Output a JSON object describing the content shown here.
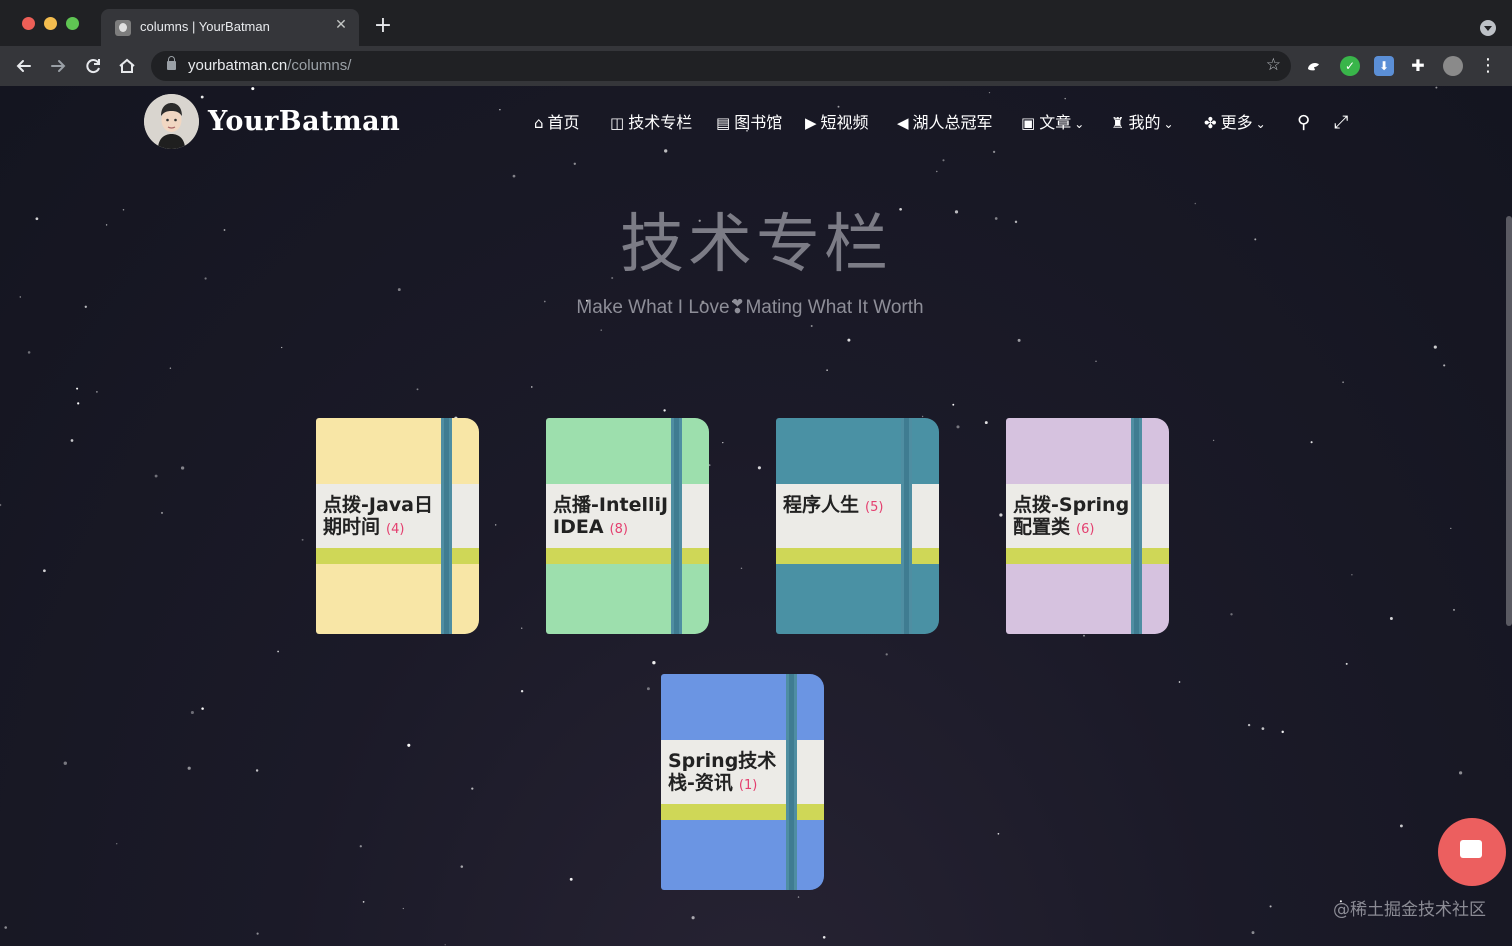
{
  "browser": {
    "tab_title": "columns | YourBatman",
    "tab_close": "✕",
    "new_tab": "+",
    "url_host": "yourbatman.cn",
    "url_path": "/columns/"
  },
  "site": {
    "title": "YourBatman",
    "nav": [
      {
        "icon": "home-icon",
        "glyph": "⌂",
        "label": "首页",
        "dropdown": false
      },
      {
        "icon": "columns-icon",
        "glyph": "◫",
        "label": "技术专栏",
        "dropdown": false
      },
      {
        "icon": "book-icon",
        "glyph": "▤",
        "label": "图书馆",
        "dropdown": false
      },
      {
        "icon": "video-icon",
        "glyph": "▶",
        "label": "短视频",
        "dropdown": false
      },
      {
        "icon": "megaphone-icon",
        "glyph": "◀",
        "label": "湖人总冠军",
        "dropdown": false
      },
      {
        "icon": "article-icon",
        "glyph": "▣",
        "label": "文章",
        "dropdown": true
      },
      {
        "icon": "user-icon",
        "glyph": "♜",
        "label": "我的",
        "dropdown": true
      },
      {
        "icon": "more-icon",
        "glyph": "✤",
        "label": "更多",
        "dropdown": true
      }
    ]
  },
  "main": {
    "heading": "技术专栏",
    "subtitle": "Make What I Love❣Mating What It Worth",
    "columns": [
      {
        "title": "点拨-Java日期时间",
        "count": "(4)",
        "color": "#f8e6a6"
      },
      {
        "title": "点播-IntelliJ IDEA",
        "count": "(8)",
        "color": "#9ddfad"
      },
      {
        "title": "程序人生",
        "count": "(5)",
        "color": "#4a91a4"
      },
      {
        "title": "点拨-Spring配置类",
        "count": "(6)",
        "color": "#d6c2df"
      },
      {
        "title": "Spring技术栈-资讯",
        "count": "(1)",
        "color": "#6b95e3"
      }
    ]
  },
  "watermark": "@稀土掘金技术社区"
}
